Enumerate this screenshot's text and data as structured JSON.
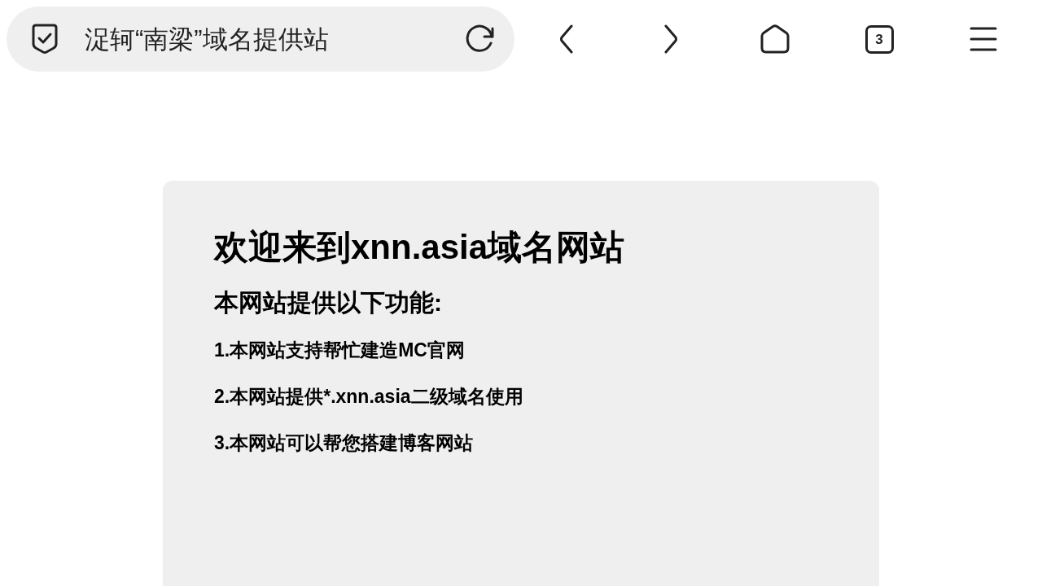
{
  "address_bar": {
    "title": "浞轲“南梁”域名提供站"
  },
  "toolbar": {
    "tab_count": "3"
  },
  "page": {
    "heading": "欢迎来到xnn.asia域名网站",
    "subheading": "本网站提供以下功能:",
    "items": [
      "1.本网站支持帮忙建造MC官网",
      "2.本网站提供*.xnn.asia二级域名使用",
      "3.本网站可以帮您搭建博客网站"
    ]
  }
}
